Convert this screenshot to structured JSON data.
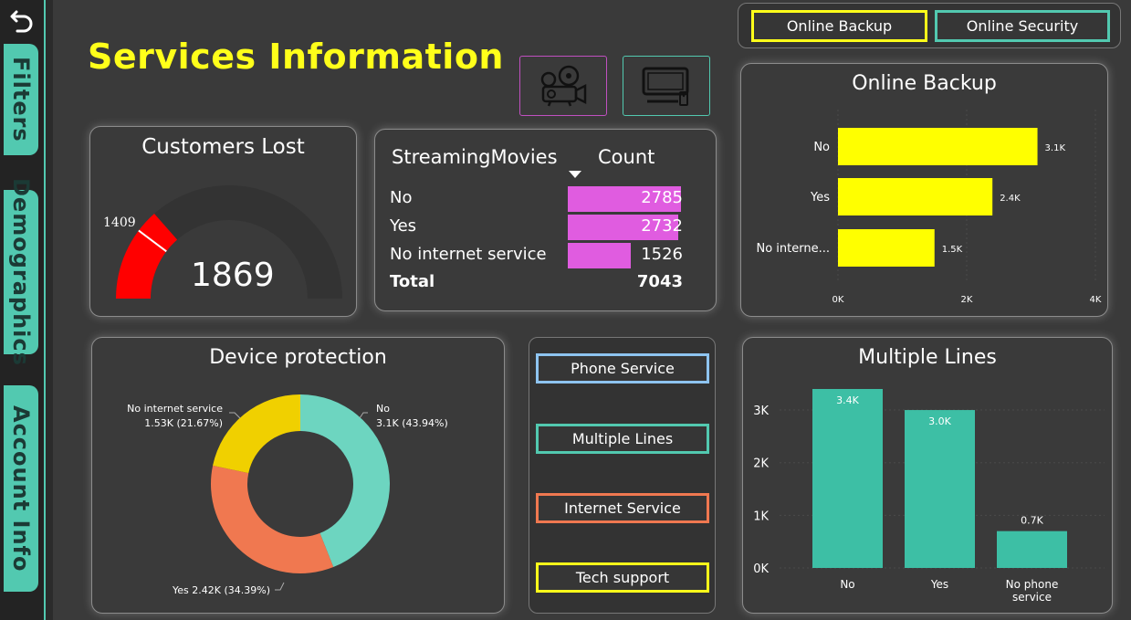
{
  "nav": {
    "back_icon": "undo-arrow-icon",
    "tabs": [
      {
        "label": "Filters"
      },
      {
        "label": "Demographics"
      },
      {
        "label": "Account Info"
      }
    ]
  },
  "page": {
    "title": "Services Information"
  },
  "toolbar": {
    "streaming_movies_icon": "movie-projector-icon",
    "streaming_tv_icon": "tv-icon",
    "top_buttons": [
      {
        "label": "Online Backup",
        "color": "#ffff1a"
      },
      {
        "label": "Online Security",
        "color": "#52c9b0"
      }
    ]
  },
  "customers_lost": {
    "title": "Customers Lost",
    "value": "1869",
    "target": "1409",
    "gauge_fraction": 0.27
  },
  "streaming_table": {
    "col1": "StreamingMovies",
    "col2": "Count",
    "rows": [
      {
        "label": "No",
        "value": "2785",
        "fraction": 0.99
      },
      {
        "label": "Yes",
        "value": "2732",
        "fraction": 0.97
      },
      {
        "label": "No internet service",
        "value": "1526",
        "fraction": 0.55
      }
    ],
    "total_label": "Total",
    "total_value": "7043",
    "bar_color": "#e05ce0"
  },
  "service_buttons": [
    {
      "label": "Phone Service",
      "color": "#8ec4f0"
    },
    {
      "label": "Multiple Lines",
      "color": "#52c9b0"
    },
    {
      "label": "Internet Service",
      "color": "#f07850"
    },
    {
      "label": "Tech support",
      "color": "#ffff1a"
    }
  ],
  "chart_data": [
    {
      "type": "bar",
      "orientation": "horizontal",
      "title": "Online Backup",
      "categories": [
        "No",
        "Yes",
        "No interne..."
      ],
      "values": [
        3.1,
        2.4,
        1.5
      ],
      "data_labels": [
        "3.1K",
        "2.4K",
        "1.5K"
      ],
      "xlim": [
        0,
        4
      ],
      "x_ticks": [
        "0K",
        "2K",
        "4K"
      ],
      "color": "#ffff00"
    },
    {
      "type": "pie",
      "subtype": "donut",
      "title": "Device protection",
      "slices": [
        {
          "label": "No",
          "value": 3.1,
          "percent": 43.94,
          "text": "No",
          "text2": "3.1K (43.94%)",
          "color": "#6dd5c0"
        },
        {
          "label": "Yes",
          "value": 2.42,
          "percent": 34.39,
          "text": "Yes 2.42K (34.39%)",
          "text2": "",
          "color": "#f07850"
        },
        {
          "label": "No internet service",
          "value": 1.53,
          "percent": 21.67,
          "text": "No internet service",
          "text2": "1.53K (21.67%)",
          "color": "#f0d000"
        }
      ]
    },
    {
      "type": "bar",
      "title": "Multiple Lines",
      "categories": [
        "No",
        "Yes",
        "No phone service"
      ],
      "category_lines": [
        [
          "No"
        ],
        [
          "Yes"
        ],
        [
          "No phone",
          "service"
        ]
      ],
      "values": [
        3.4,
        3.0,
        0.7
      ],
      "data_labels": [
        "3.4K",
        "3.0K",
        "0.7K"
      ],
      "ylim": [
        0,
        3.4
      ],
      "y_ticks": [
        {
          "v": 0,
          "t": "0K"
        },
        {
          "v": 1,
          "t": "1K"
        },
        {
          "v": 2,
          "t": "2K"
        },
        {
          "v": 3,
          "t": "3K"
        }
      ],
      "color": "#3dbfa5"
    }
  ]
}
